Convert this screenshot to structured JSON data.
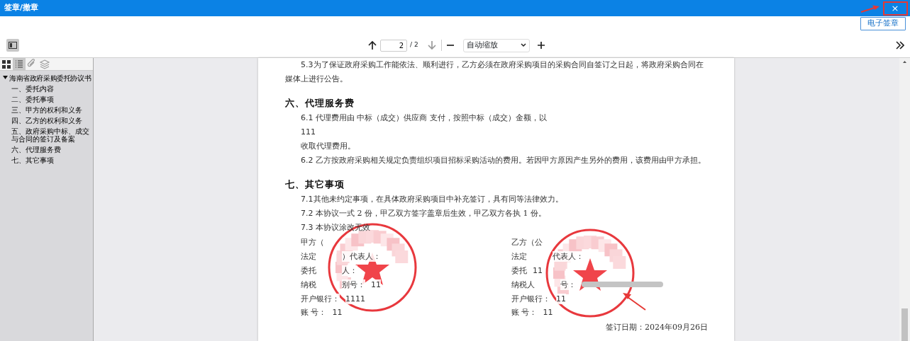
{
  "window": {
    "title": "签章/撤章",
    "close": "×"
  },
  "sign_button": "电子签章",
  "toolbar": {
    "nav": [
      {
        "kind": "prev",
        "disabled": false
      },
      {
        "kind": "next",
        "disabled": true
      }
    ],
    "page": "2",
    "page_count": "/ 2",
    "zoom": "自动缩放"
  },
  "sidebar": {
    "tabs": [
      {
        "kind": "thumbnails",
        "selected": false
      },
      {
        "kind": "outline",
        "selected": true
      },
      {
        "kind": "attachments",
        "selected": false
      },
      {
        "kind": "layers",
        "selected": false
      }
    ],
    "outline": [
      {
        "label": "海南省政府采购委托协议书",
        "expanded": true,
        "children": [
          {
            "label": "一、委托内容"
          },
          {
            "label": "二、委托事项"
          },
          {
            "label": "三、甲方的权利和义务"
          },
          {
            "label": "四、乙方的权利和义务"
          },
          {
            "label": "五、政府采购中标、成交与合同的签订及备案"
          },
          {
            "label": "六、代理服务费"
          },
          {
            "label": "七、其它事项"
          }
        ]
      }
    ]
  },
  "document": {
    "blocks": [
      {
        "kind": "para",
        "num": "5.3",
        "text": "为了保证政府采购工作能依法、顺利进行，乙方必须在政府采购项目的采购合同自签订之日起，将政府采购合同在媒体上进行公告。"
      },
      {
        "kind": "heading",
        "text": "六、代理服务费"
      },
      {
        "kind": "para",
        "num": "6.1",
        "text": " 代理费用由 中标（成交）供应商 支付，按照中标（成交）金额，以"
      },
      {
        "kind": "value",
        "text": "111"
      },
      {
        "kind": "line",
        "text": "收取代理费用。"
      },
      {
        "kind": "para",
        "num": "6.2",
        "text": " 乙方按政府采购相关规定负责组织项目招标采购活动的费用。若因甲方原因产生另外的费用，该费用由甲方承担。"
      },
      {
        "kind": "heading",
        "text": "七、其它事项"
      },
      {
        "kind": "para",
        "num": "7.1",
        "text": "其他未约定事项，在具体政府采购项目中补充签订，具有同等法律效力。"
      },
      {
        "kind": "para",
        "num": "7.2",
        "text": " 本协议一式 2 份，甲乙双方签字盖章后生效，甲乙双方各执 1 份。"
      },
      {
        "kind": "para",
        "num": "7.3",
        "text": " 本协议涂改无效"
      }
    ],
    "parties": [
      {
        "sealed": true,
        "rows": [
          {
            "label": "甲方（",
            "redacted": false
          },
          {
            "label": "法定",
            "tail": "）代表人：",
            "redacted": false
          },
          {
            "label": "委托",
            "tail": "人：",
            "redacted": false
          },
          {
            "label": "纳税",
            "tail": "别号：",
            "value": "11",
            "redacted": false
          },
          {
            "label": "开户银行：",
            "value": "1111",
            "redacted": false
          },
          {
            "label": "账 号：",
            "value": "11",
            "redacted": false
          }
        ]
      },
      {
        "sealed": true,
        "rows": [
          {
            "label": "乙方（公",
            "redacted": false
          },
          {
            "label": "法定",
            "tail": "代表人：",
            "redacted": false
          },
          {
            "label": "委托",
            "value": "11",
            "redacted": false
          },
          {
            "label": "纳税人",
            "tail": "号：",
            "redacted": true
          },
          {
            "label": "开户银行：",
            "value": "11",
            "redacted": false
          },
          {
            "label": "账 号：",
            "value": "11",
            "redacted": false
          }
        ]
      }
    ],
    "sign_date": "签订日期：2024年09月26日"
  }
}
